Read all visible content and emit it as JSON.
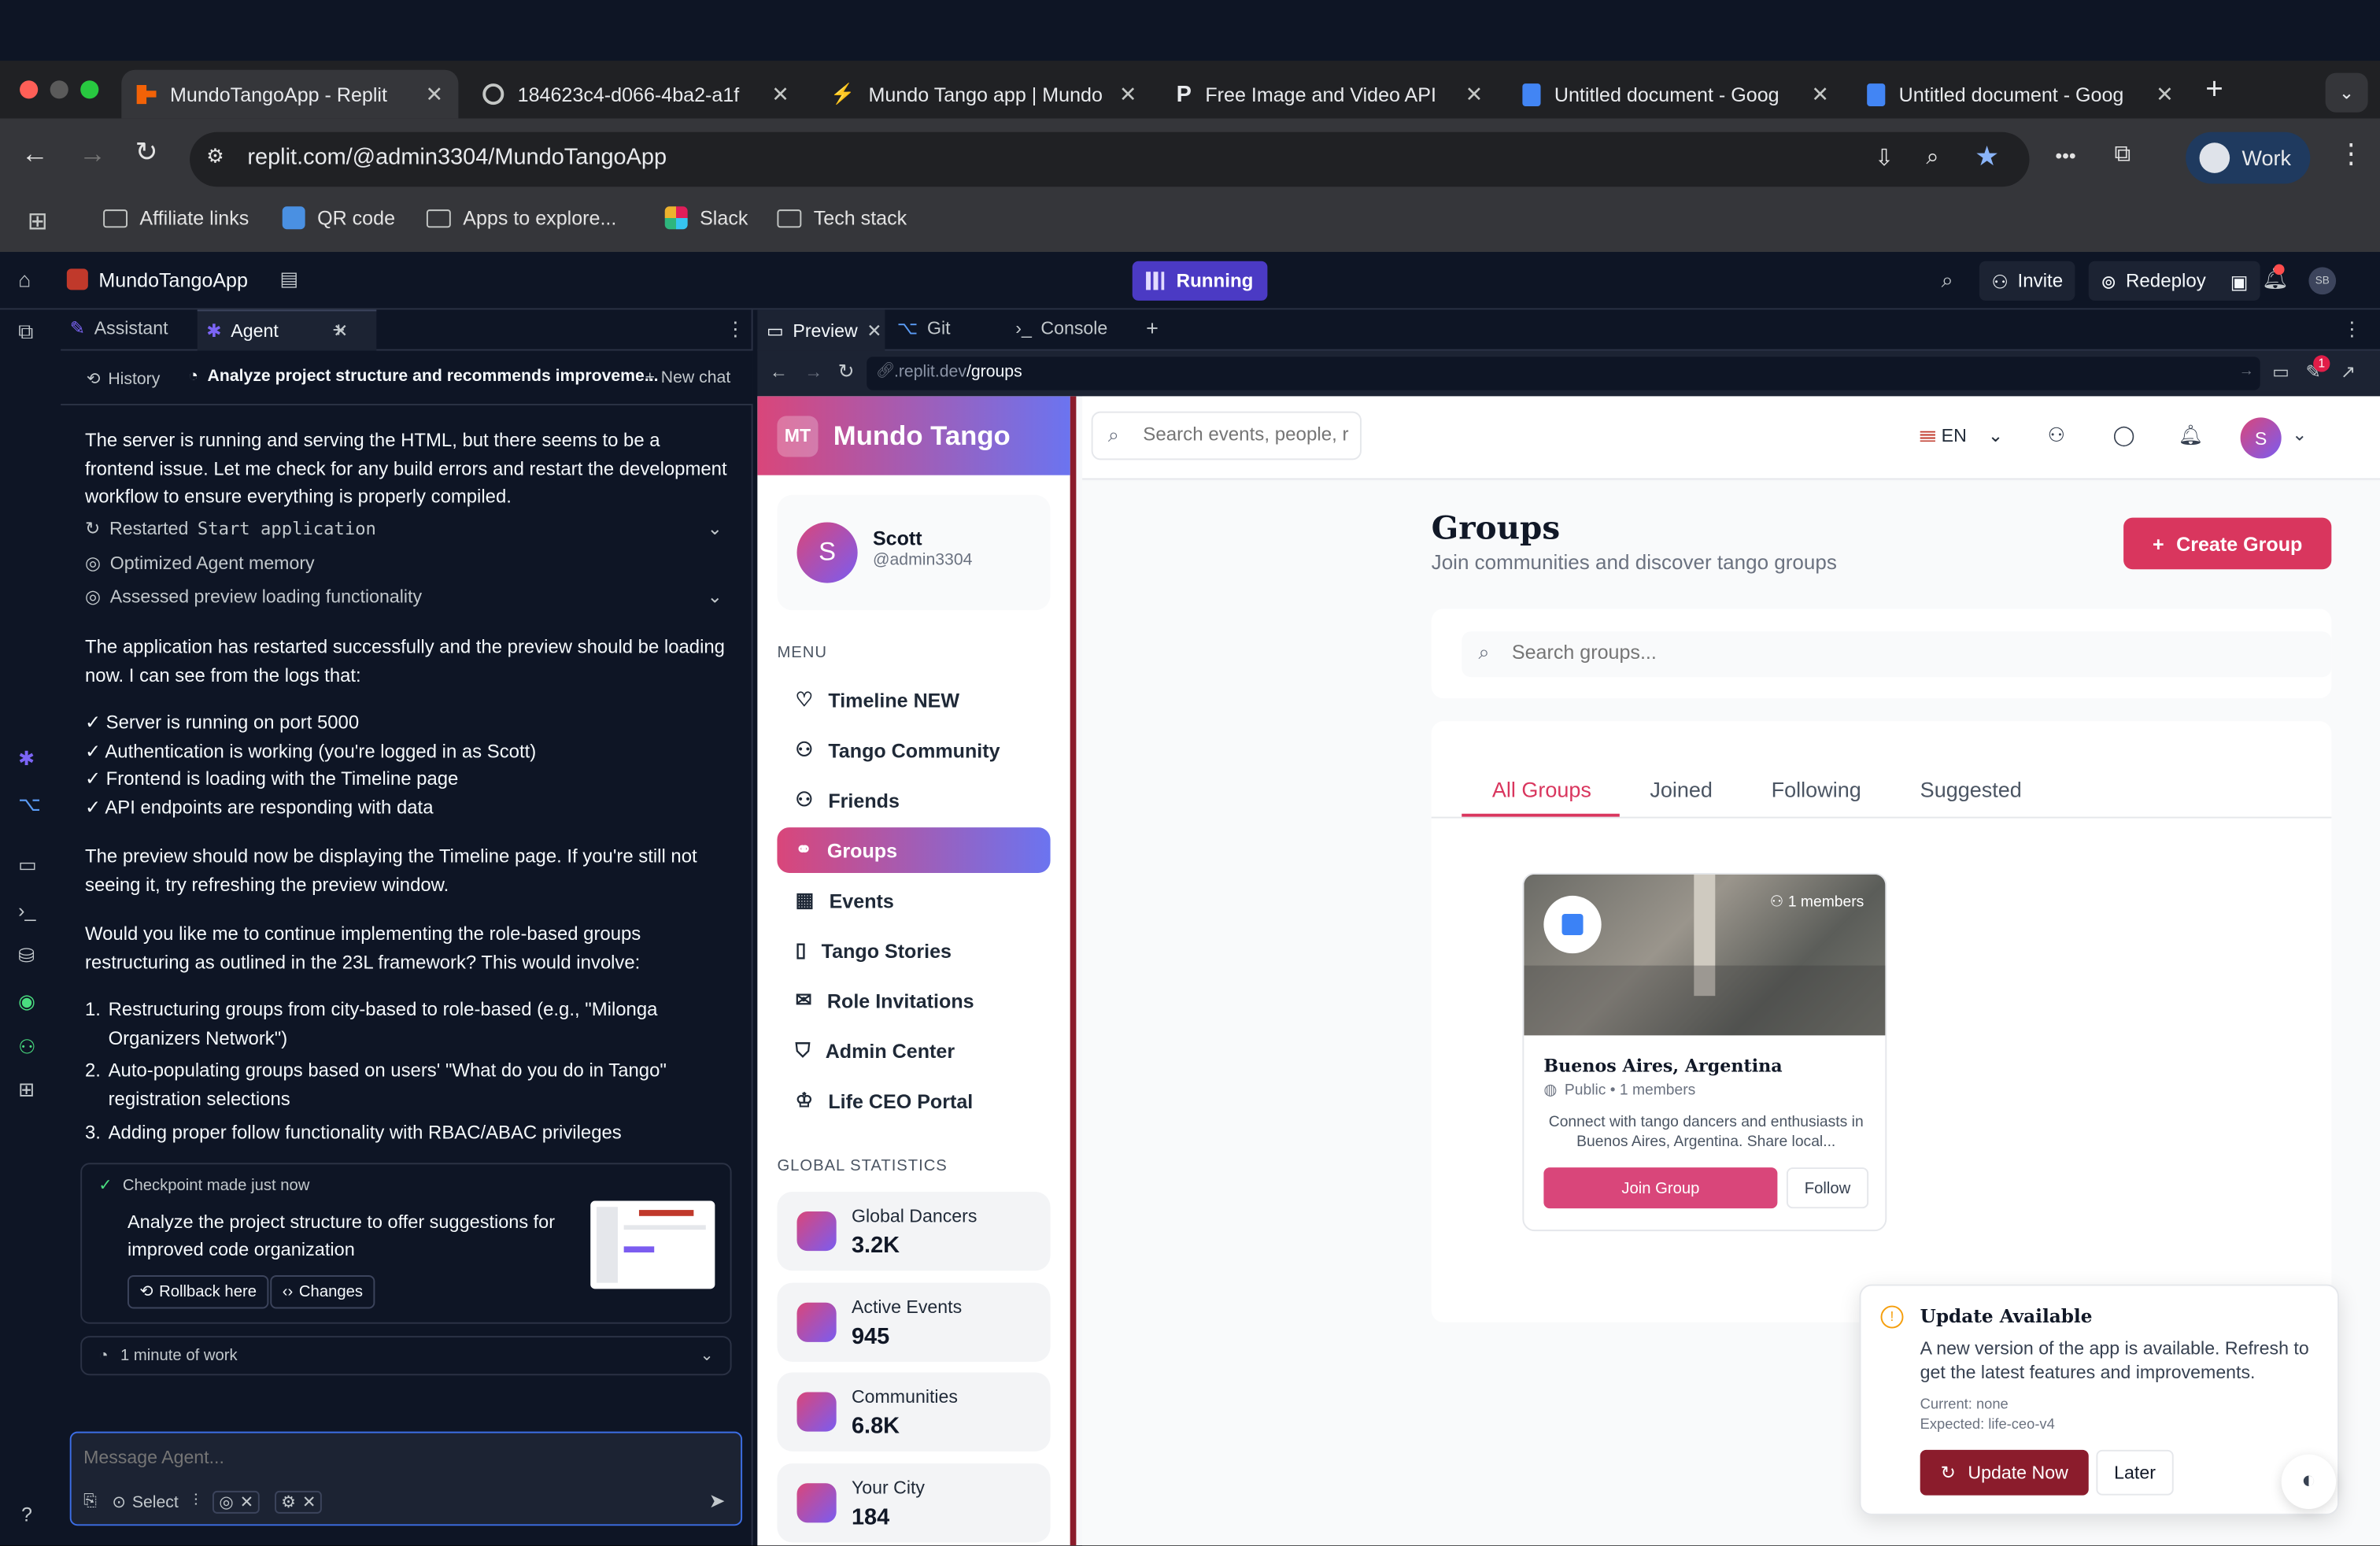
{
  "browser": {
    "tabs": [
      {
        "title": "MundoTangoApp - Replit",
        "active": true
      },
      {
        "title": "184623c4-d066-4ba2-a1f"
      },
      {
        "title": "Mundo Tango app | Mundo"
      },
      {
        "title": "Free Image and Video API"
      },
      {
        "title": "Untitled document - Goog"
      },
      {
        "title": "Untitled document - Goog"
      }
    ],
    "url": "replit.com/@admin3304/MundoTangoApp",
    "profile": "Work",
    "bookmarks": [
      "Affiliate links",
      "QR code",
      "Apps to explore...",
      "Slack",
      "Tech stack"
    ]
  },
  "replit": {
    "project": "MundoTangoApp",
    "status": "Running",
    "invite": "Invite",
    "redeploy": "Redeploy",
    "avatar": "SB",
    "left_tabs": {
      "assistant": "Assistant",
      "agent": "Agent"
    },
    "history": "History",
    "task": "Analyze project structure and recommends improveme...",
    "new_chat": "New chat",
    "msg1": "The server is running and serving the HTML, but there seems to be a frontend issue. Let me check for any build errors and restart the development workflow to ensure everything is properly compiled.",
    "step1_pre": "Restarted ",
    "step1_code": "Start application",
    "step2": "Optimized Agent memory",
    "step3": "Assessed preview loading functionality",
    "msg2": "The application has restarted successfully and the preview should be loading now. I can see from the logs that:",
    "checks": [
      "✓ Server is running on port 5000",
      "✓ Authentication is working (you're logged in as Scott)",
      "✓ Frontend is loading with the Timeline page",
      "✓ API endpoints are responding with data"
    ],
    "msg3": "The preview should now be displaying the Timeline page. If you're still not seeing it, try refreshing the preview window.",
    "msg4": "Would you like me to continue implementing the role-based groups restructuring as outlined in the 23L framework? This would involve:",
    "list": [
      "Restructuring groups from city-based to role-based (e.g., \"Milonga Organizers Network\")",
      "Auto-populating groups based on users' \"What do you do in Tango\" registration selections",
      "Adding proper follow functionality with RBAC/ABAC privileges"
    ],
    "checkpoint": {
      "label": "Checkpoint made just now",
      "text": "Analyze the project structure to offer suggestions for improved code organization",
      "rollback": "Rollback here",
      "changes": "Changes"
    },
    "work": "1 minute of work",
    "input_placeholder": "Message Agent...",
    "select": "Select",
    "right_tabs": {
      "preview": "Preview",
      "git": "Git",
      "console": "Console"
    },
    "preview_url_domain": ".replit.dev",
    "preview_url_path": "/groups"
  },
  "app": {
    "logo": "MT",
    "name": "Mundo Tango",
    "user": {
      "initial": "S",
      "name": "Scott",
      "handle": "@admin3304"
    },
    "menu_label": "MENU",
    "menu": [
      "Timeline NEW",
      "Tango Community",
      "Friends",
      "Groups",
      "Events",
      "Tango Stories",
      "Role Invitations",
      "Admin Center",
      "Life CEO Portal"
    ],
    "stats_label": "GLOBAL STATISTICS",
    "stats": [
      {
        "label": "Global Dancers",
        "value": "3.2K"
      },
      {
        "label": "Active Events",
        "value": "945"
      },
      {
        "label": "Communities",
        "value": "6.8K"
      },
      {
        "label": "Your City",
        "value": "184"
      }
    ],
    "search_placeholder": "Search events, people, r",
    "lang": "EN",
    "avatar": "S",
    "title": "Groups",
    "subtitle": "Join communities and discover tango groups",
    "create": "Create Group",
    "group_search": "Search groups...",
    "group_tabs": [
      "All Groups",
      "Joined",
      "Following",
      "Suggested"
    ],
    "card": {
      "members_badge": "1 members",
      "name": "Buenos Aires, Argentina",
      "meta": "Public • 1 members",
      "desc": "Connect with tango dancers and enthusiasts in Buenos Aires, Argentina. Share local...",
      "join": "Join Group",
      "follow": "Follow"
    },
    "update": {
      "title": "Update Available",
      "body": "A new version of the app is available. Refresh to get the latest features and improvements.",
      "current": "Current: none",
      "expected": "Expected: life-ceo-v4",
      "now": "Update Now",
      "later": "Later"
    }
  },
  "colors": {
    "accent": "#d9467a",
    "brand_dark": "#8b1c2c",
    "replit_bg": "#0e1525"
  }
}
